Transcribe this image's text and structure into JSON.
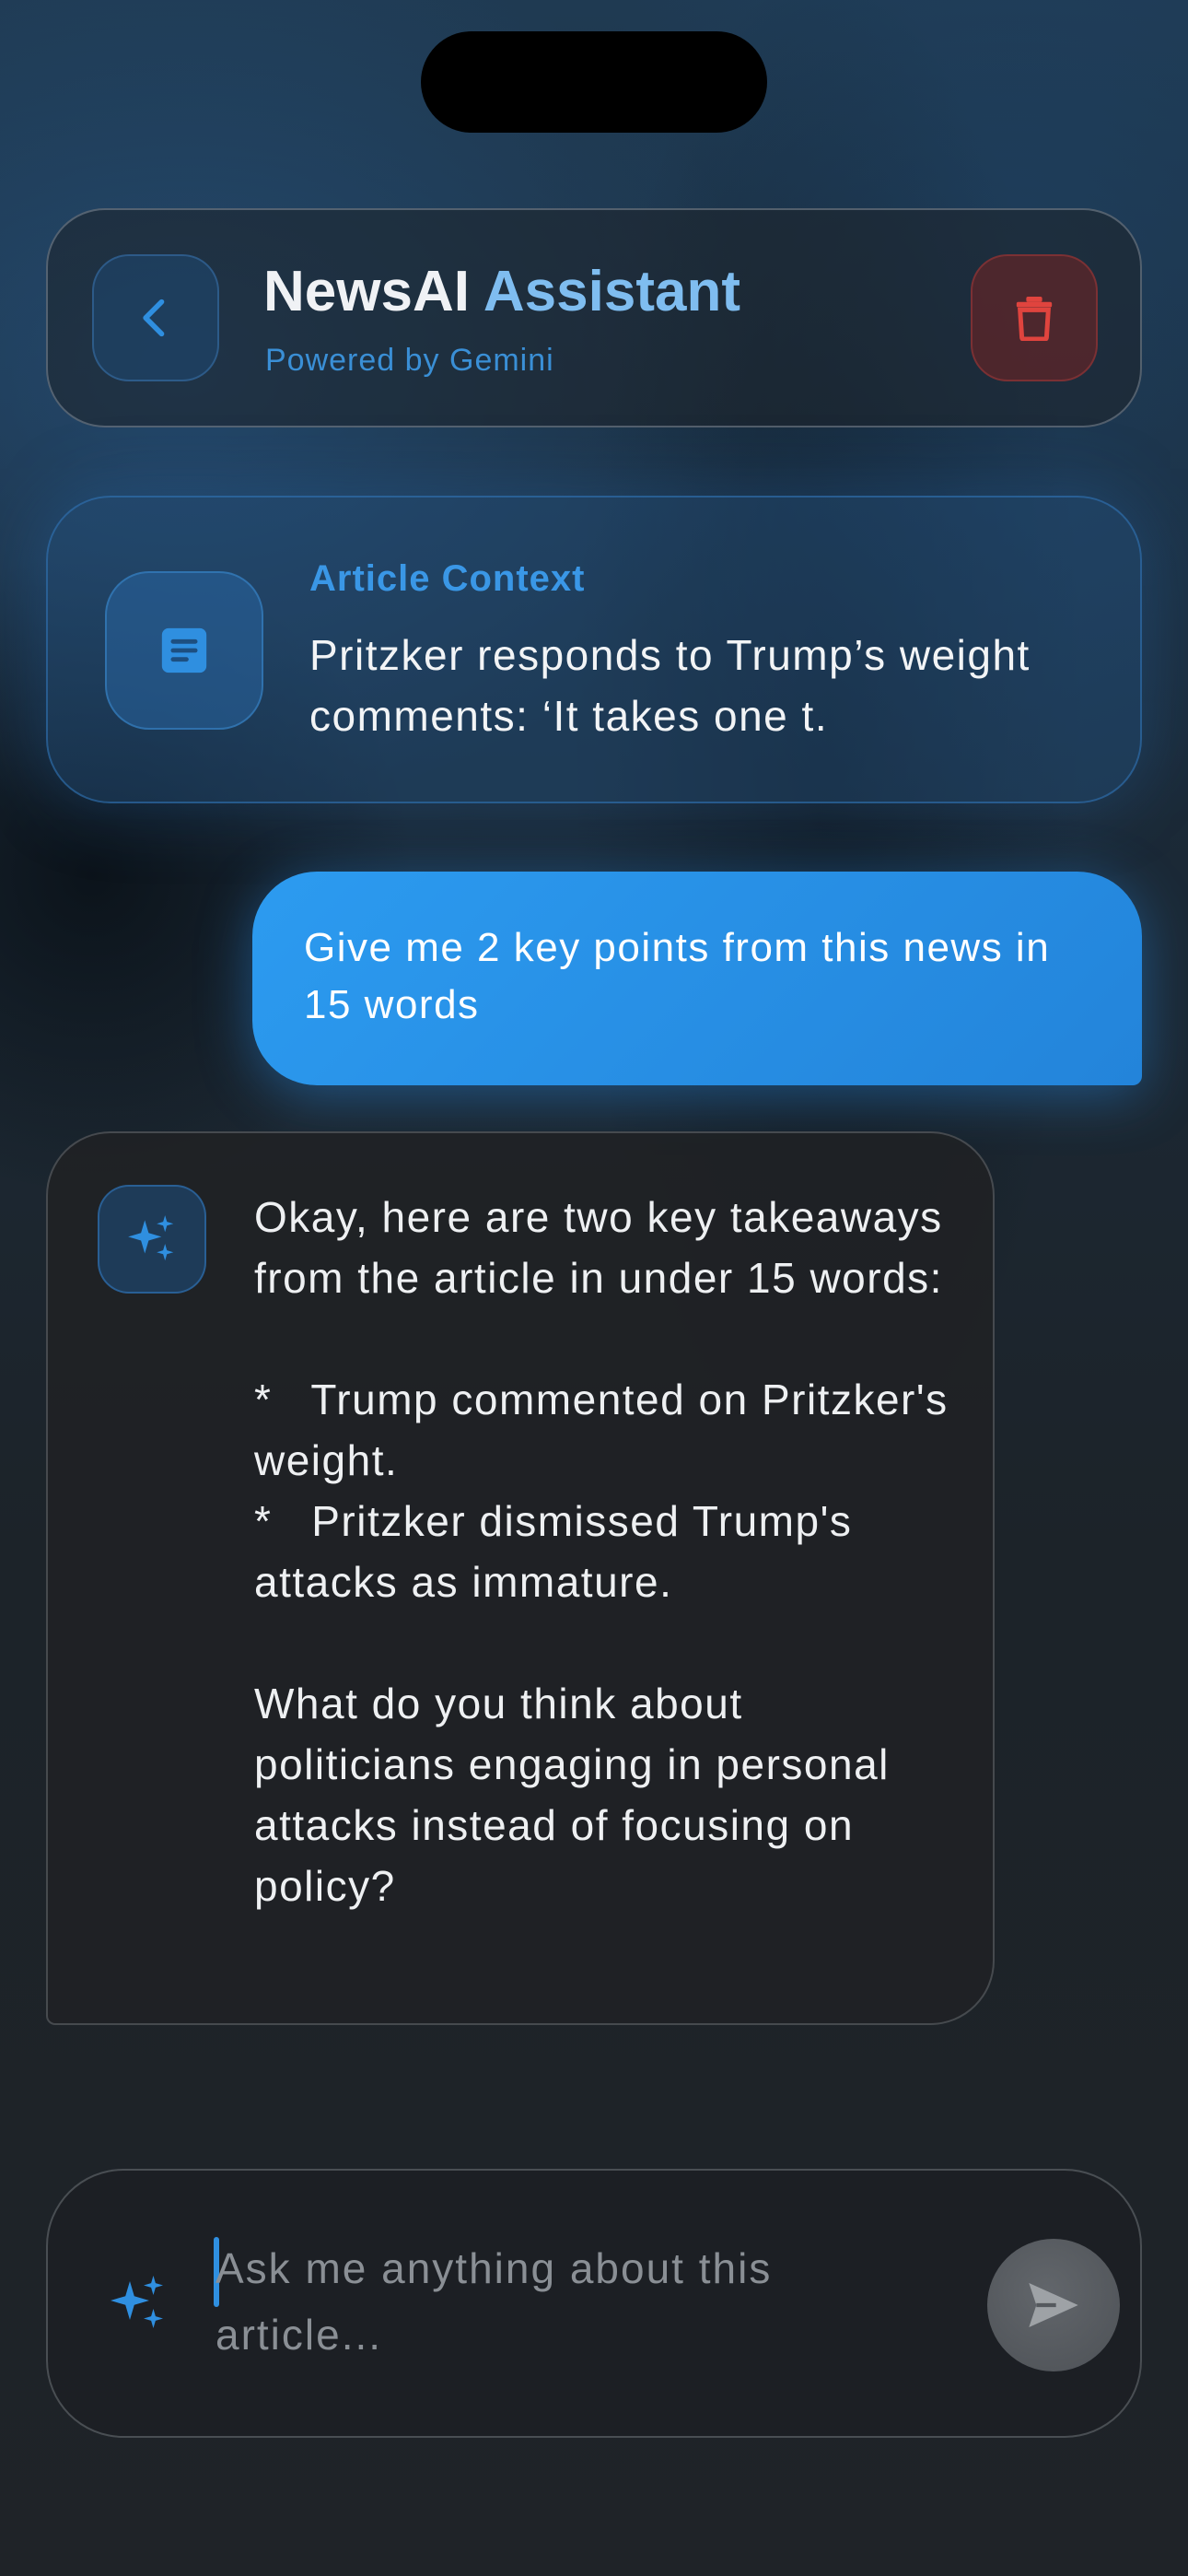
{
  "header": {
    "title_part1": "NewsAI",
    "title_part2": "Assistant",
    "subtitle": "Powered by Gemini",
    "back_icon": "chevron-left-icon",
    "delete_icon": "trash-icon"
  },
  "article_context": {
    "label": "Article Context",
    "text": "Pritzker responds to Trump’s weight comments: ‘It takes one t.",
    "icon": "document-icon"
  },
  "messages": {
    "user": {
      "text": "Give me 2 key points from this news in 15 words"
    },
    "assistant": {
      "icon": "sparkle-icon",
      "text": "Okay, here are two key takeaways from the article in under 15 words:\n\n*   Trump commented on Pritzker's weight.\n*   Pritzker dismissed Trump's attacks as immature.\n\nWhat do you think about politicians engaging in personal attacks instead of focusing on policy?"
    }
  },
  "composer": {
    "placeholder": "Ask me anything about this article...",
    "value": "",
    "sparkle_icon": "sparkle-icon",
    "send_icon": "send-icon"
  },
  "colors": {
    "accent": "#2f8fe0",
    "user_bubble": "#2c9bf0",
    "delete": "#e0443e",
    "title_accent": "#7fbdf0"
  }
}
